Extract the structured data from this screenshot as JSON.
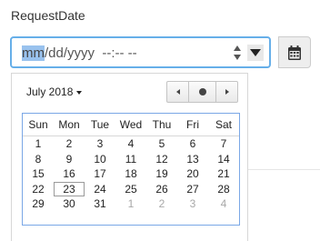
{
  "field": {
    "label": "RequestDate",
    "value_selected_segment": "mm",
    "value_rest": "/dd/yyyy  --:-- --"
  },
  "icons": {
    "spin_up": "chevron-up-icon",
    "spin_down": "chevron-down-icon",
    "dropdown": "caret-down-icon",
    "calendar": "calendar-icon",
    "prev": "chevron-left-icon",
    "today": "dot-icon",
    "next": "chevron-right-icon"
  },
  "picker": {
    "month_label": "July 2018",
    "weekdays": [
      "Sun",
      "Mon",
      "Tue",
      "Wed",
      "Thu",
      "Fri",
      "Sat"
    ],
    "weeks": [
      [
        {
          "d": "1",
          "m": "cur"
        },
        {
          "d": "2",
          "m": "cur"
        },
        {
          "d": "3",
          "m": "cur"
        },
        {
          "d": "4",
          "m": "cur"
        },
        {
          "d": "5",
          "m": "cur"
        },
        {
          "d": "6",
          "m": "cur"
        },
        {
          "d": "7",
          "m": "cur"
        }
      ],
      [
        {
          "d": "8",
          "m": "cur"
        },
        {
          "d": "9",
          "m": "cur"
        },
        {
          "d": "10",
          "m": "cur"
        },
        {
          "d": "11",
          "m": "cur"
        },
        {
          "d": "12",
          "m": "cur"
        },
        {
          "d": "13",
          "m": "cur"
        },
        {
          "d": "14",
          "m": "cur"
        }
      ],
      [
        {
          "d": "15",
          "m": "cur"
        },
        {
          "d": "16",
          "m": "cur"
        },
        {
          "d": "17",
          "m": "cur"
        },
        {
          "d": "18",
          "m": "cur"
        },
        {
          "d": "19",
          "m": "cur"
        },
        {
          "d": "20",
          "m": "cur"
        },
        {
          "d": "21",
          "m": "cur"
        }
      ],
      [
        {
          "d": "22",
          "m": "cur"
        },
        {
          "d": "23",
          "m": "cur",
          "today": true
        },
        {
          "d": "24",
          "m": "cur"
        },
        {
          "d": "25",
          "m": "cur"
        },
        {
          "d": "26",
          "m": "cur"
        },
        {
          "d": "27",
          "m": "cur"
        },
        {
          "d": "28",
          "m": "cur"
        }
      ],
      [
        {
          "d": "29",
          "m": "cur"
        },
        {
          "d": "30",
          "m": "cur"
        },
        {
          "d": "31",
          "m": "cur"
        },
        {
          "d": "1",
          "m": "next"
        },
        {
          "d": "2",
          "m": "next"
        },
        {
          "d": "3",
          "m": "next"
        },
        {
          "d": "4",
          "m": "next"
        }
      ]
    ]
  },
  "colors": {
    "focus_border": "#66afe9",
    "selection": "#99c2ee",
    "grid_border": "#7aa7e6",
    "other_month_text": "#a8a8a8"
  }
}
